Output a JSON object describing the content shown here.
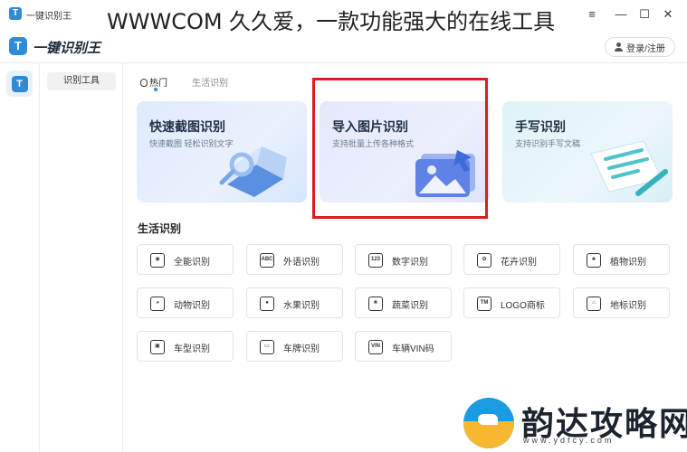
{
  "window": {
    "app_name": "一键识别王",
    "overlay_title": "WWWCOM 久久爱，一款功能强大的在线工具",
    "logo_glyph": "T"
  },
  "header": {
    "title": "一键识别王",
    "login_label": "登录/注册"
  },
  "sidebar": {
    "menu_item": "识别工具"
  },
  "tabs": [
    {
      "label": "热门",
      "active": true
    },
    {
      "label": "生活识别",
      "active": false
    }
  ],
  "cards": [
    {
      "title": "快速截图识别",
      "subtitle": "快速截图 轻松识别文字"
    },
    {
      "title": "导入图片识别",
      "subtitle": "支持批量上传各种格式"
    },
    {
      "title": "手写识别",
      "subtitle": "支持识别手写文稿"
    }
  ],
  "section": {
    "title": "生活识别"
  },
  "tools": [
    {
      "label": "全能识别",
      "icon": "eye-icon",
      "glyph": "◉"
    },
    {
      "label": "外语识别",
      "icon": "abc-icon",
      "glyph": "ABC"
    },
    {
      "label": "数字识别",
      "icon": "123-icon",
      "glyph": "123"
    },
    {
      "label": "花卉识别",
      "icon": "flower-icon",
      "glyph": "✿"
    },
    {
      "label": "植物识别",
      "icon": "plant-icon",
      "glyph": "♣"
    },
    {
      "label": "动物识别",
      "icon": "animal-icon",
      "glyph": "◕"
    },
    {
      "label": "水果识别",
      "icon": "fruit-icon",
      "glyph": "●"
    },
    {
      "label": "蔬菜识别",
      "icon": "vegetable-icon",
      "glyph": "❀"
    },
    {
      "label": "LOGO商标",
      "icon": "logo-icon",
      "glyph": "TM"
    },
    {
      "label": "地标识别",
      "icon": "landmark-icon",
      "glyph": "⌂"
    },
    {
      "label": "车型识别",
      "icon": "car-icon",
      "glyph": "▣"
    },
    {
      "label": "车牌识别",
      "icon": "license-plate-icon",
      "glyph": "▭"
    },
    {
      "label": "车辆VIN码",
      "icon": "vin-icon",
      "glyph": "VIN"
    }
  ],
  "watermark": {
    "name": "韵达攻略网",
    "url": "www.ydfcy.com"
  }
}
